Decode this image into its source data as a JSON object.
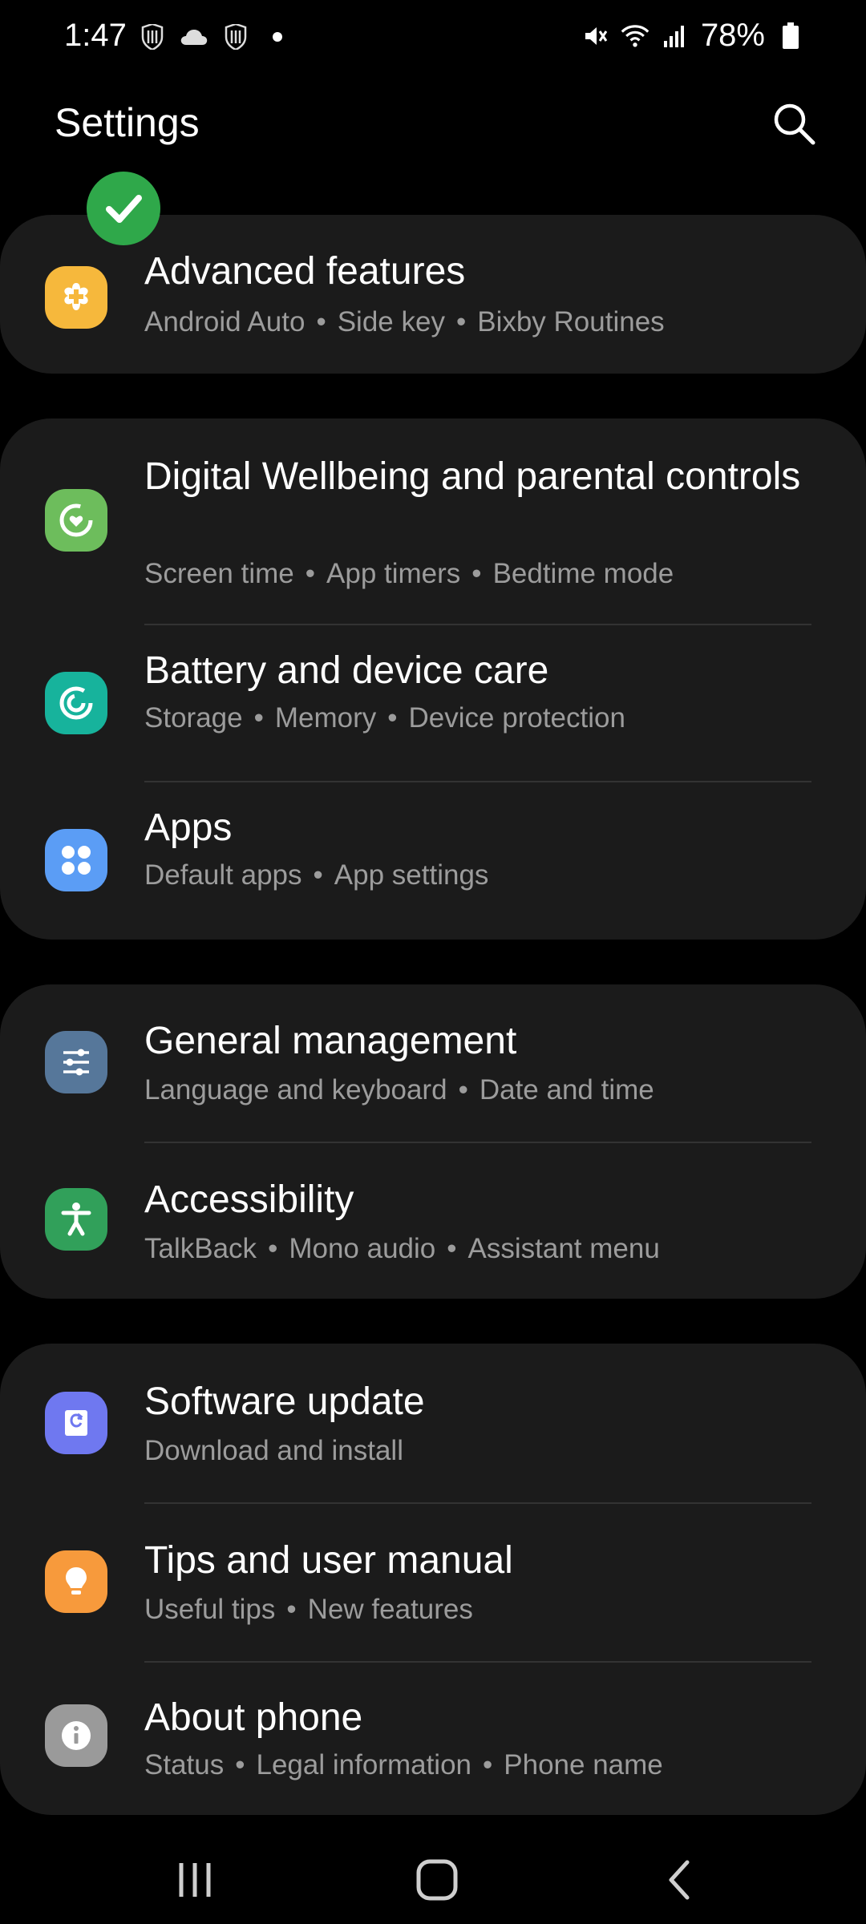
{
  "status_bar": {
    "time": "1:47",
    "battery": "78%",
    "left_icons": [
      "shield-app-icon",
      "cloud-icon",
      "shield-app-icon",
      "dot-icon"
    ],
    "right_icons": [
      "vibrate-mute-icon",
      "wifi-icon",
      "signal-icon",
      "battery-icon"
    ]
  },
  "header": {
    "title": "Settings"
  },
  "groups": [
    {
      "items": [
        {
          "title": "Advanced features",
          "subs": [
            "Android Auto",
            "Side key",
            "Bixby Routines"
          ],
          "icon": "advanced-features-icon",
          "icon_color": "#f6b83c"
        }
      ]
    },
    {
      "items": [
        {
          "title": "Digital Wellbeing and parental controls",
          "subs": [
            "Screen time",
            "App timers",
            "Bedtime mode"
          ],
          "icon": "digital-wellbeing-icon",
          "icon_color": "#6dbd5c"
        },
        {
          "title": "Battery and device care",
          "subs": [
            "Storage",
            "Memory",
            "Device protection"
          ],
          "icon": "device-care-icon",
          "icon_color": "#17b39c"
        },
        {
          "title": "Apps",
          "subs": [
            "Default apps",
            "App settings"
          ],
          "icon": "apps-icon",
          "icon_color": "#5b9df5"
        }
      ]
    },
    {
      "items": [
        {
          "title": "General management",
          "subs": [
            "Language and keyboard",
            "Date and time"
          ],
          "icon": "general-management-icon",
          "icon_color": "#56779a"
        },
        {
          "title": "Accessibility",
          "subs": [
            "TalkBack",
            "Mono audio",
            "Assistant menu"
          ],
          "icon": "accessibility-icon",
          "icon_color": "#31a05a"
        }
      ]
    },
    {
      "items": [
        {
          "title": "Software update",
          "subs": [
            "Download and install"
          ],
          "icon": "software-update-icon",
          "icon_color": "#6f78f0"
        },
        {
          "title": "Tips and user manual",
          "subs": [
            "Useful tips",
            "New features"
          ],
          "icon": "tips-icon",
          "icon_color": "#f79a3c"
        },
        {
          "title": "About phone",
          "subs": [
            "Status",
            "Legal information",
            "Phone name"
          ],
          "icon": "about-phone-icon",
          "icon_color": "#9a9a9a"
        }
      ]
    }
  ],
  "colors": {
    "background": "#000000",
    "card": "#1b1b1b",
    "subtitle": "#9c9c9c",
    "check_badge": "#2fa84a"
  },
  "nav_bar": {
    "buttons": [
      "recent-apps-icon",
      "home-icon",
      "back-icon"
    ]
  }
}
